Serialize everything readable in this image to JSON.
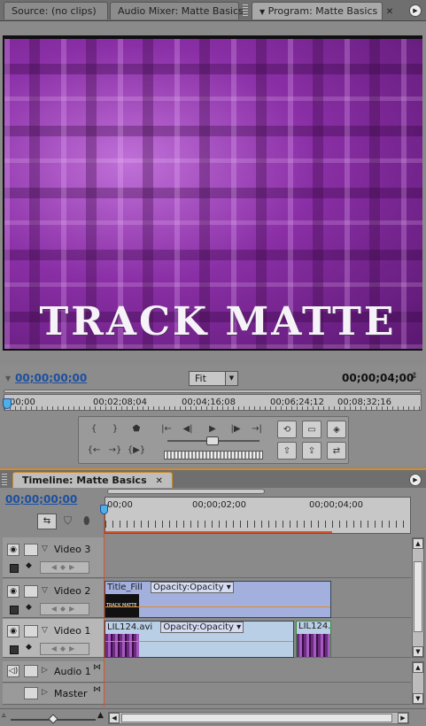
{
  "program_panel": {
    "tabs": [
      {
        "label": "Source: (no clips)"
      },
      {
        "label": "Audio Mixer: Matte Basics"
      },
      {
        "label": "Program: Matte Basics",
        "close": "✕"
      }
    ],
    "video_text": "TRACK MATTE",
    "current_timecode": "00;00;00;00",
    "duration_timecode": "00;00;04;00",
    "zoom_select": "Fit",
    "ruler_ticks": [
      "00;00",
      "00;02;08;04",
      "00;04;16;08",
      "00;06;24;12",
      "00;08;32;16"
    ]
  },
  "timeline_panel": {
    "tab_label": "Timeline: Matte Basics",
    "close": "✕",
    "current_timecode": "00;00;00;00",
    "ruler_ticks": [
      "00;00",
      "00;00;02;00",
      "00;00;04;00"
    ],
    "tracks": [
      {
        "name": "Video 3"
      },
      {
        "name": "Video 2",
        "clip_name": "Title_Fill",
        "clip_effect": "Opacity:Opacity",
        "thumb_text": "TRACK MATTE"
      },
      {
        "name": "Video 1",
        "clip_name": "LIL124.avi",
        "clip_effect": "Opacity:Opacity",
        "clip2_name": "LIL124."
      },
      {
        "name": "Audio 1"
      },
      {
        "name": "Master"
      }
    ]
  },
  "colors": {
    "timecode_blue": "#1c4fa0",
    "focus_orange": "#d48a2a",
    "playhead": "#d3542a"
  }
}
